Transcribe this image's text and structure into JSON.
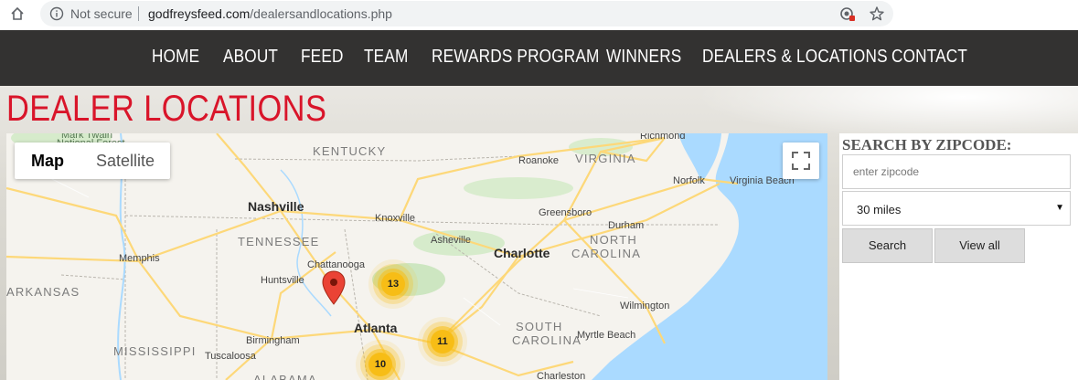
{
  "browser": {
    "security_label": "Not secure",
    "url_domain": "godfreysfeed.com",
    "url_path": "/dealersandlocations.php",
    "icons": [
      "home-icon",
      "info-icon",
      "extension-icon",
      "star-icon"
    ]
  },
  "nav": {
    "items": [
      "HOME",
      "ABOUT",
      "FEED",
      "TEAM",
      "REWARDS PROGRAM",
      "WINNERS",
      "DEALERS & LOCATIONS",
      "CONTACT"
    ]
  },
  "page": {
    "title": "DEALER LOCATIONS",
    "title_color": "#d9152a"
  },
  "map": {
    "map_type": {
      "map_label": "Map",
      "satellite_label": "Satellite",
      "selected": "Map"
    },
    "states": [
      "KENTUCKY",
      "VIRGINIA",
      "TENNESSEE",
      "NORTH CAROLINA",
      "ARKANSAS",
      "SOUTH CAROLINA",
      "MISSISSIPPI",
      "ALABAMA"
    ],
    "forest": [
      "Mark Twain",
      "National Forest"
    ],
    "cities": {
      "richmond": "Richmond",
      "roanoke": "Roanoke",
      "norfolk": "Norfolk",
      "virginia_beach": "Virginia Beach",
      "nashville": "Nashville",
      "knoxville": "Knoxville",
      "greensboro": "Greensboro",
      "durham": "Durham",
      "asheville": "Asheville",
      "charlotte": "Charlotte",
      "memphis": "Memphis",
      "chattanooga": "Chattanooga",
      "huntsville": "Huntsville",
      "wilmington": "Wilmington",
      "atlanta": "Atlanta",
      "birmingham": "Birmingham",
      "tuscaloosa": "Tuscaloosa",
      "myrtle_beach": "Myrtle Beach",
      "charleston": "Charleston"
    },
    "clusters": [
      "13",
      "11",
      "10"
    ],
    "cluster_color": "#f7bd16",
    "marker_color": "#ea4335"
  },
  "search": {
    "heading": "SEARCH BY ZIPCODE:",
    "zip_placeholder": "enter zipcode",
    "zip_value": "",
    "radius_selected": "30 miles",
    "search_label": "Search",
    "view_all_label": "View all"
  }
}
